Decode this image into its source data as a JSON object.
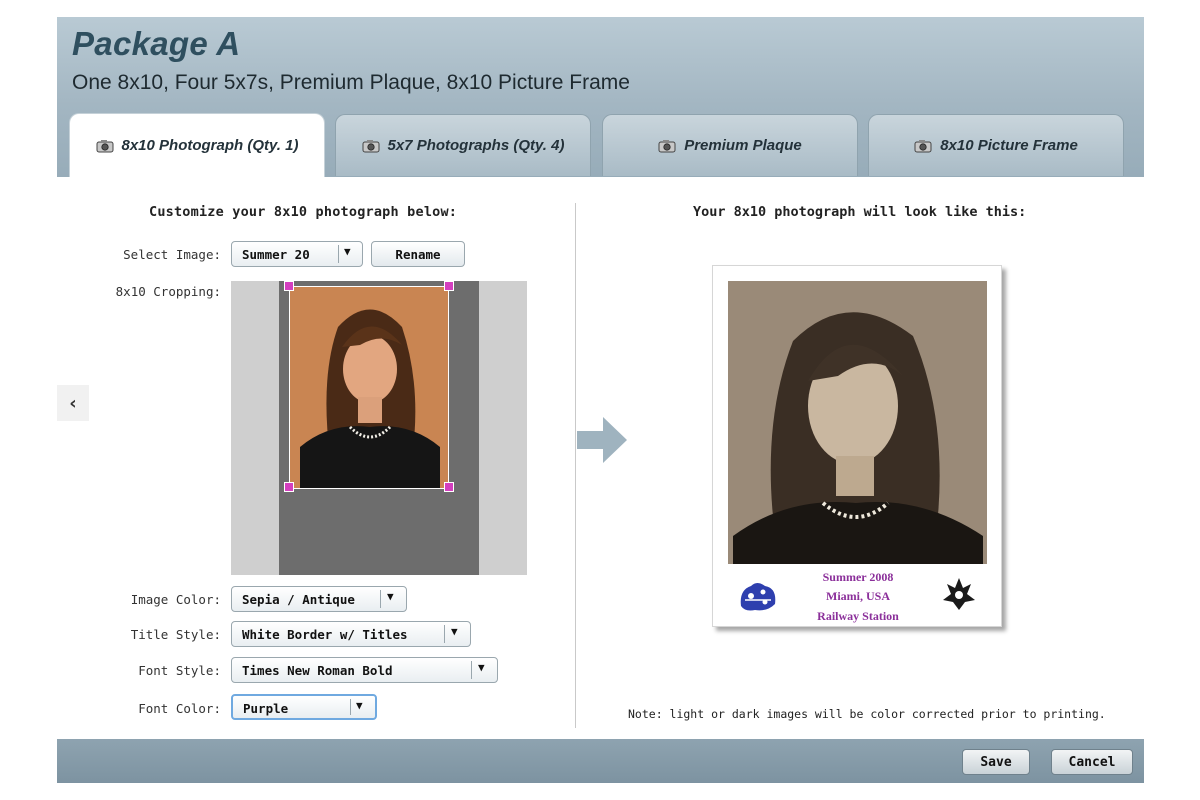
{
  "package": {
    "title": "Package A",
    "subtitle": "One 8x10, Four 5x7s, Premium Plaque, 8x10 Picture Frame"
  },
  "tabs": [
    {
      "label": "8x10 Photograph (Qty. 1)",
      "icon": "camera-icon",
      "active": true
    },
    {
      "label": "5x7 Photographs (Qty. 4)",
      "icon": "camera-icon",
      "active": false
    },
    {
      "label": "Premium Plaque",
      "icon": "camera-icon",
      "active": false
    },
    {
      "label": "8x10 Picture Frame",
      "icon": "camera-icon",
      "active": false
    }
  ],
  "left": {
    "heading": "Customize your 8x10 photograph below:",
    "select_image": {
      "label": "Select Image:",
      "value": "Summer 20",
      "rename_label": "Rename"
    },
    "cropping_label": "8x10 Cropping:",
    "image_color": {
      "label": "Image Color:",
      "value": "Sepia / Antique"
    },
    "title_style": {
      "label": "Title Style:",
      "value": "White Border w/ Titles"
    },
    "font_style": {
      "label": "Font Style:",
      "value": "Times New Roman Bold"
    },
    "font_color": {
      "label": "Font Color:",
      "value": "Purple"
    }
  },
  "right": {
    "heading": "Your 8x10 photograph will look like this:",
    "preview_titles": [
      "Summer 2008",
      "Miami, USA",
      "Railway Station"
    ],
    "title_color": "#8b2f9a",
    "note": "Note: light or dark images will be color corrected prior to printing."
  },
  "footer": {
    "save_label": "Save",
    "cancel_label": "Cancel"
  },
  "colors": {
    "header_bg": "#a3b6c2",
    "title_color": "#2f4f5f",
    "crop_handle": "#d43fbf",
    "arrow": "#9fb3bf"
  },
  "icons": {
    "dropdown": "▼",
    "left_nav": "‹"
  }
}
